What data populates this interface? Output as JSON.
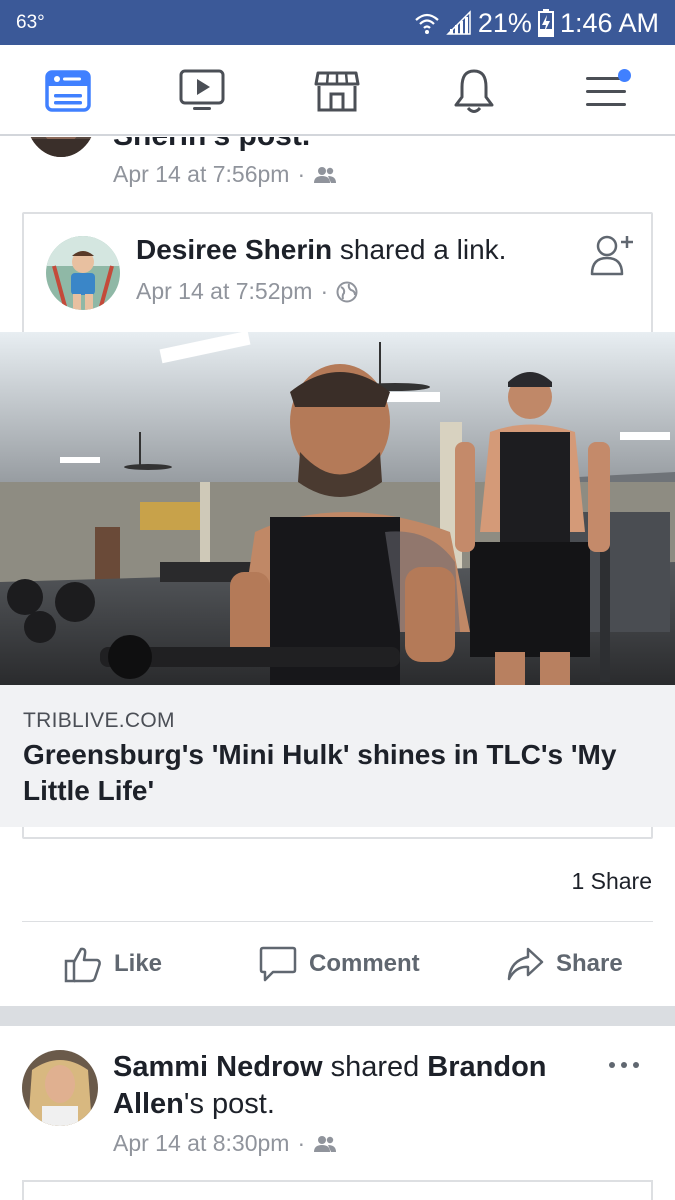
{
  "status_bar": {
    "temperature": "63°",
    "battery": "21%",
    "time": "1:46 AM"
  },
  "nav": {
    "items": [
      "news-feed-icon",
      "watch-icon",
      "marketplace-icon",
      "notifications-icon",
      "menu-icon"
    ],
    "accent": "#4080ff",
    "menu_has_badge": true
  },
  "previous_post": {
    "title_fragment": "Sherin's post.",
    "timestamp": "Apr 14 at 7:56pm",
    "audience": "friends-icon"
  },
  "shared_post": {
    "author": "Desiree Sherin",
    "action": "shared a link.",
    "timestamp": "Apr 14 at 7:52pm",
    "audience": "globe-icon",
    "link": {
      "domain": "TRIBLIVE.COM",
      "title": "Greensburg's 'Mini Hulk' shines in TLC's 'My Little Life'"
    },
    "share_count": "1 Share",
    "actions": {
      "like": "Like",
      "comment": "Comment",
      "share": "Share"
    }
  },
  "next_post": {
    "author": "Sammi Nedrow",
    "action": "shared",
    "shared_author": "Brandon Allen",
    "suffix": "'s post.",
    "timestamp": "Apr 14 at 8:30pm",
    "audience": "friends-icon"
  }
}
